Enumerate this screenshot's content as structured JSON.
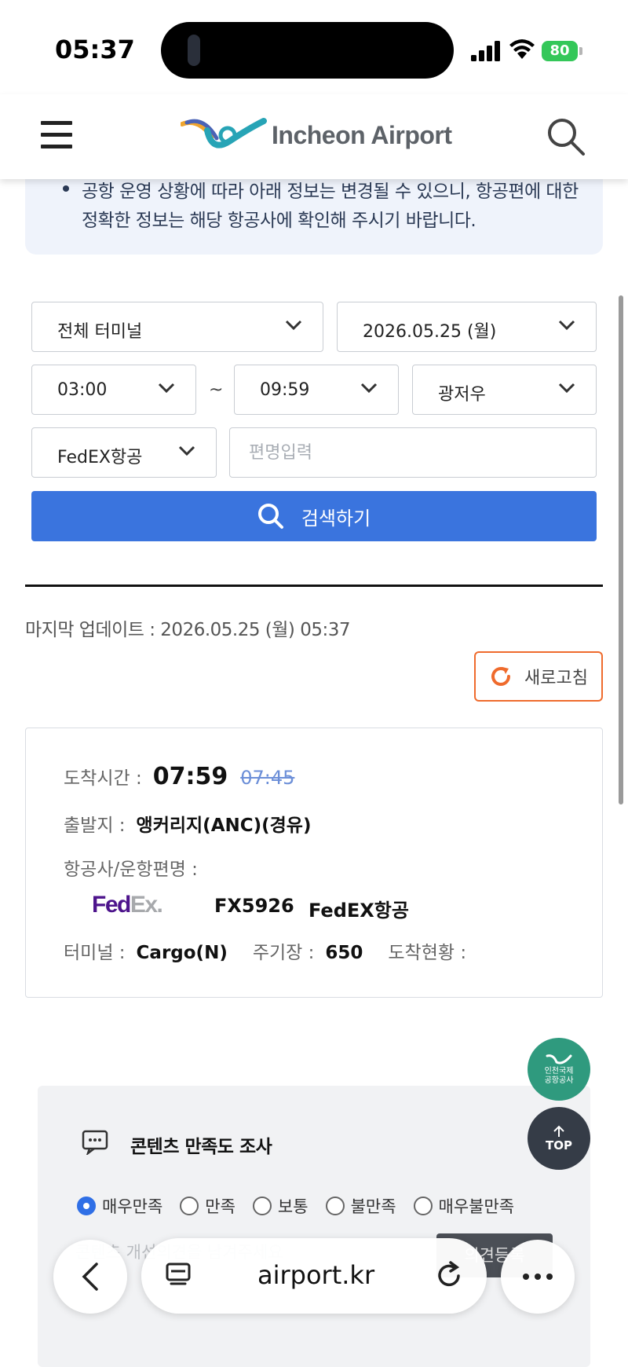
{
  "status_bar": {
    "time": "05:37",
    "battery": "80"
  },
  "header": {
    "logo_text": "Incheon Airport"
  },
  "notice": {
    "text": "공항 운영 상황에 따라 아래 정보는 변경될 수 있으니, 항공편에 대한 정확한 정보는 해당 항공사에 확인해 주시기 바랍니다."
  },
  "filters": {
    "terminal": "전체 터미널",
    "date": "2026.05.25 (월)",
    "time_from": "03:00",
    "tilde": "~",
    "time_to": "09:59",
    "city": "광저우",
    "airline": "FedEX항공",
    "flight_placeholder": "편명입력",
    "search_label": "검색하기"
  },
  "update": {
    "text": "마지막 업데이트 : 2026.05.25 (월) 05:37",
    "refresh_label": "새로고침"
  },
  "flight": {
    "arrival_label": "도착시간 :",
    "arrival_time": "07:59",
    "scheduled_time": "07:45",
    "origin_label": "출발지 :",
    "origin": "앵커리지(ANC)(경유)",
    "airline_label": "항공사/운항편명 :",
    "logo_fed": "Fed",
    "logo_ex": "Ex.",
    "flight_no": "FX5926",
    "airline_name": "FedEX항공",
    "terminal_label": "터미널 :",
    "terminal": "Cargo(N)",
    "stand_label": "주기장 :",
    "stand": "650",
    "status_label": "도착현황 :",
    "status": ""
  },
  "floating": {
    "org_line1": "인천국제",
    "org_line2": "공항공사",
    "top_label": "TOP"
  },
  "survey": {
    "title": "콘텐츠 만족도 조사",
    "options": [
      "매우만족",
      "만족",
      "보통",
      "불만족",
      "매우불만족"
    ],
    "selected": "매우만족",
    "input_placeholder": "콘텐츠 개선의견을 남겨주세요",
    "submit_label": "의견등록"
  },
  "browser": {
    "url": "airport.kr"
  },
  "colors": {
    "primary": "#3a74de",
    "refresh_accent": "#ef6b2d",
    "fedex_purple": "#4d148c",
    "fedex_gray": "#a7a9ac"
  }
}
